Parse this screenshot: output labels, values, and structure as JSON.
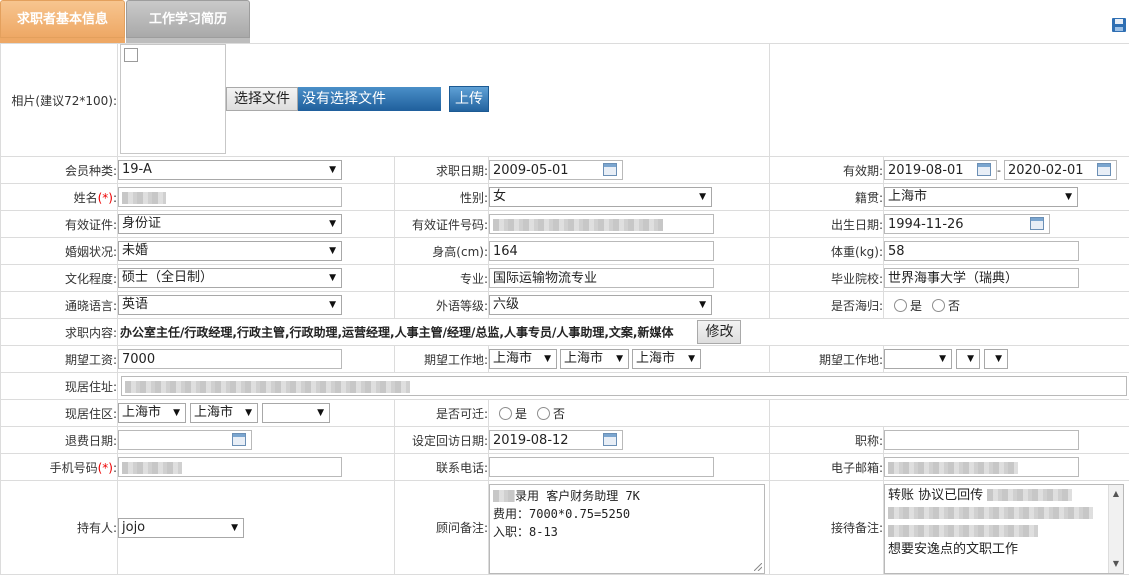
{
  "tabs": [
    "求职者基本信息",
    "工作学习简历"
  ],
  "colors": {
    "tab_active": "#eea865",
    "tab_inactive": "#a9a9a9",
    "required": "#e00000"
  },
  "icons": {
    "save": "floppy-disk-icon",
    "calendar": "calendar-icon",
    "dropdown": "chevron-down-icon"
  },
  "photo": {
    "label": "相片(建议72*100):",
    "choose": "选择文件",
    "no_file": "没有选择文件",
    "upload": "上传"
  },
  "labels": {
    "member_type": "会员种类:",
    "apply_date": "求职日期:",
    "valid_period": "有效期:",
    "name": "姓名",
    "gender": "性别:",
    "native_place": "籍贯:",
    "id_type": "有效证件:",
    "id_number": "有效证件号码:",
    "birth_date": "出生日期:",
    "marital": "婚姻状况:",
    "height": "身高(cm):",
    "weight": "体重(kg):",
    "education": "文化程度:",
    "major": "专业:",
    "school": "毕业院校:",
    "language": "通晓语言:",
    "language_level": "外语等级:",
    "returnee": "是否海归:",
    "job_content": "求职内容:",
    "expected_salary": "期望工资:",
    "expected_location": "期望工作地:",
    "expected_location2": "期望工作地:",
    "current_address": "现居住址:",
    "current_district": "现居住区:",
    "relocate": "是否可迁:",
    "refund_date": "退费日期:",
    "revisit_date": "设定回访日期:",
    "title": "职称:",
    "mobile": "手机号码",
    "phone": "联系电话:",
    "email": "电子邮箱:",
    "owner": "持有人:",
    "consultant_note": "顾问备注:",
    "reception_note": "接待备注:"
  },
  "required_mark": "(*)",
  "colon": ":",
  "values": {
    "member_type": "19-A",
    "apply_date": "2009-05-01",
    "valid_from": "2019-08-01",
    "valid_sep": "-",
    "valid_to": "2020-02-01",
    "gender": "女",
    "native_place": "上海市",
    "id_type": "身份证",
    "birth_date": "1994-11-26",
    "marital": "未婚",
    "height": "164",
    "weight": "58",
    "education": "硕士（全日制）",
    "major": "国际运输物流专业",
    "school": "世界海事大学（瑞典）",
    "language": "英语",
    "language_level": "六级",
    "yes": "是",
    "no": "否",
    "job_content": "办公室主任/行政经理,行政主管,行政助理,运营经理,人事主管/经理/总监,人事专员/人事助理,文案,新媒体",
    "modify": "修改",
    "expected_salary": "7000",
    "loc1": "上海市",
    "loc2": "上海市",
    "loc3": "上海市",
    "loc4": "",
    "loc5": "",
    "loc6": "",
    "dist1": "上海市",
    "dist2": "上海市",
    "dist3": "",
    "refund_date": "",
    "revisit_date": "2019-08-12",
    "title": "",
    "phone": "",
    "owner": "jojo",
    "consultant_note": [
      "录用 客户财务助理 7K",
      "费用：7000*0.75=5250",
      "入职：8-13"
    ],
    "reception_note_top": "转账 协议已回传",
    "reception_note_bottom": "想要安逸点的文职工作"
  }
}
